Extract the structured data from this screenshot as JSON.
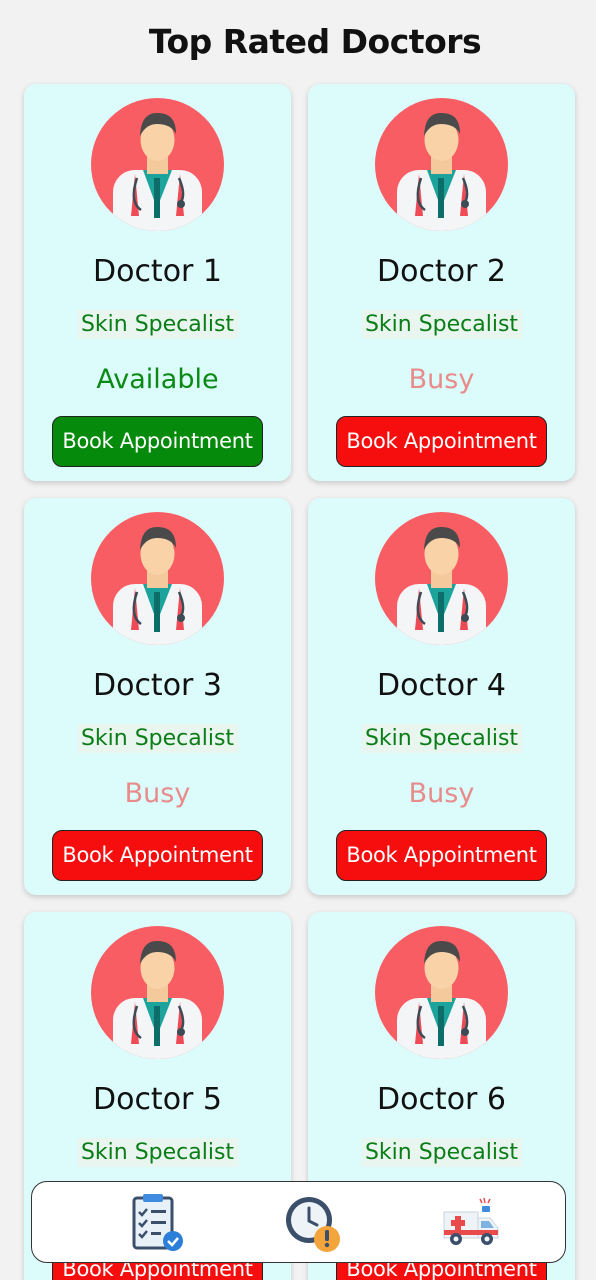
{
  "page": {
    "title": "Top Rated Doctors"
  },
  "doctors": [
    {
      "name": "Doctor 1",
      "specialty": "Skin Specalist",
      "status": "Available",
      "status_type": "available",
      "button_label": "Book Appointment"
    },
    {
      "name": "Doctor 2",
      "specialty": "Skin Specalist",
      "status": "Busy",
      "status_type": "busy",
      "button_label": "Book Appointment"
    },
    {
      "name": "Doctor 3",
      "specialty": "Skin Specalist",
      "status": "Busy",
      "status_type": "busy",
      "button_label": "Book Appointment"
    },
    {
      "name": "Doctor 4",
      "specialty": "Skin Specalist",
      "status": "Busy",
      "status_type": "busy",
      "button_label": "Book Appointment"
    },
    {
      "name": "Doctor 5",
      "specialty": "Skin Specalist",
      "status": "",
      "status_type": "unknown",
      "button_label": "Book Appointment"
    },
    {
      "name": "Doctor 6",
      "specialty": "Skin Specalist",
      "status": "",
      "status_type": "unknown",
      "button_label": "Book Appointment"
    }
  ],
  "bottom_nav": {
    "items": [
      {
        "icon": "clipboard-checklist-icon"
      },
      {
        "icon": "clock-alert-icon"
      },
      {
        "icon": "ambulance-icon"
      }
    ]
  },
  "colors": {
    "card_bg": "#dcfbfb",
    "available": "#0a8a14",
    "busy": "#e88b8b",
    "book_green": "#058a0b",
    "book_red": "#f60d0d",
    "avatar_bg": "#f85d63",
    "specialty_text": "#0a7d17"
  }
}
